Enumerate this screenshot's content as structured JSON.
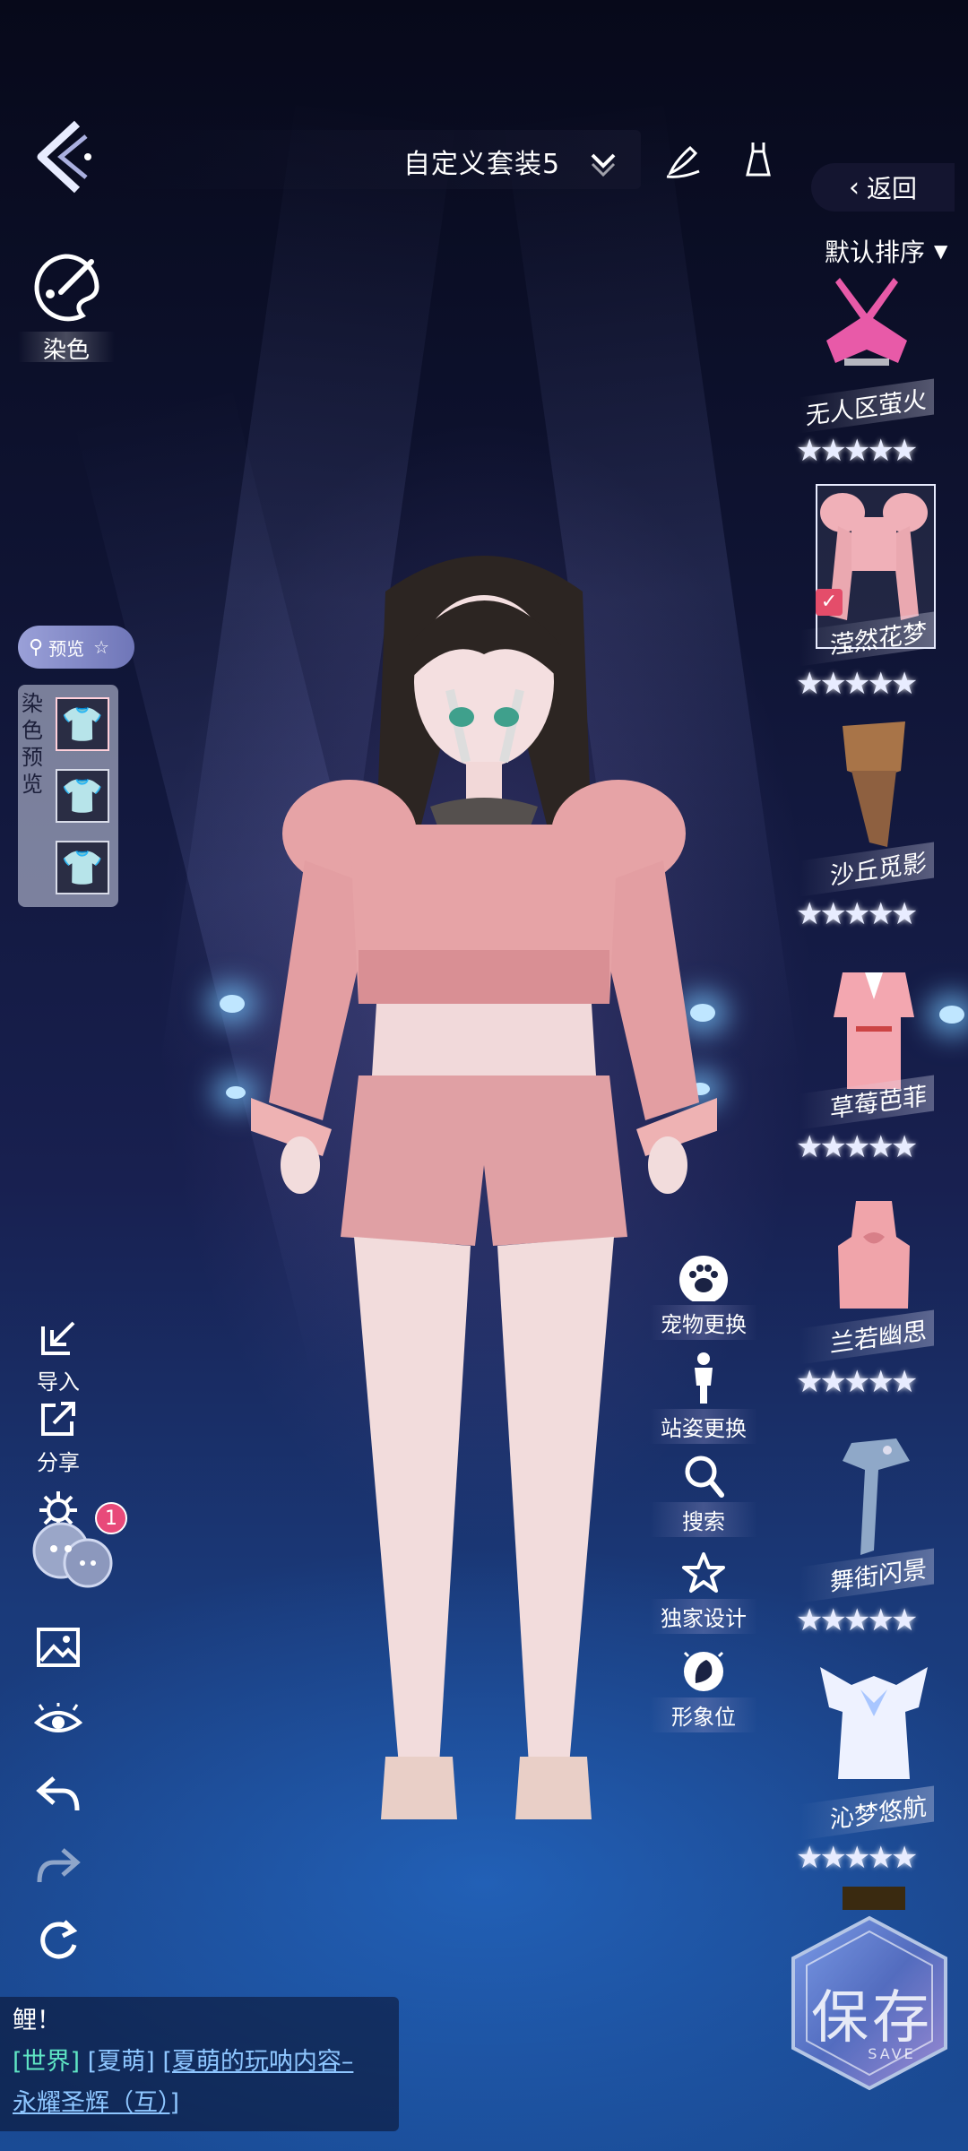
{
  "header": {
    "outfit_title": "自定义套装5",
    "return_label": "返回",
    "sort_label": "默认排序"
  },
  "dye": {
    "label": "染色"
  },
  "preview": {
    "pill_label": "预览",
    "panel_label": "染色预览"
  },
  "left_tools": {
    "import_label": "导入",
    "share_label": "分享",
    "badge_count": "1"
  },
  "actions": [
    {
      "label": "宠物更换",
      "icon": "paw-icon"
    },
    {
      "label": "站姿更换",
      "icon": "standing-person-icon"
    },
    {
      "label": "搜索",
      "icon": "search-icon"
    },
    {
      "label": "独家设计",
      "icon": "star-icon"
    },
    {
      "label": "形象位",
      "icon": "avatar-slot-icon"
    }
  ],
  "wardrobe": {
    "items": [
      {
        "name": "无人区萤火",
        "color": "#e85aa8"
      },
      {
        "name": "滢然花梦",
        "color": "#f0b0b8",
        "selected": true
      },
      {
        "name": "沙丘觅影",
        "color": "#a87448"
      },
      {
        "name": "草莓芭菲",
        "color": "#f3a7b0"
      },
      {
        "name": "兰若幽思",
        "color": "#f0a4aa"
      },
      {
        "name": "舞街闪景",
        "color": "#8fa8c8"
      },
      {
        "name": "沁梦悠航",
        "color": "#eaf0ff"
      }
    ],
    "stars_text": "★★★★★"
  },
  "chat": {
    "line1": "鲤！",
    "channel": "[世界]",
    "user": "[夏萌]",
    "link_part1": "[夏萌的玩呐内容–",
    "link_part2": "永耀圣辉（互）]"
  },
  "save": {
    "label": "保存",
    "sub": "SAVE"
  },
  "colors": {
    "accent_blue": "#1a4b95",
    "outfit_pink": "#e6a3a6"
  }
}
